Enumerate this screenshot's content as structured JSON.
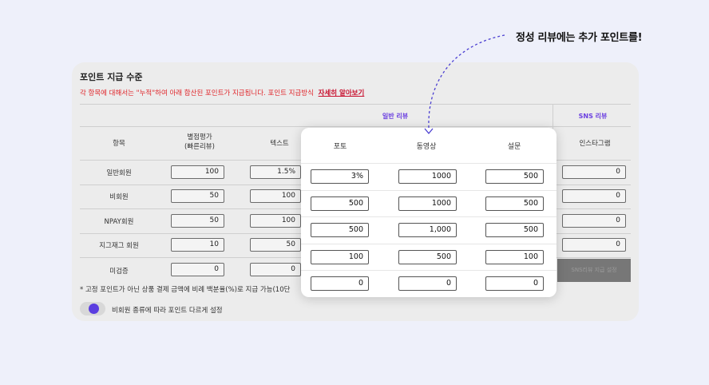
{
  "callout": "정성 리뷰에는 추가 포인트를!",
  "card": {
    "title": "포인트 지급 수준",
    "notice": "각 항목에 대해서는 \"누적\"하여 아래 합산된 포인트가 지급됩니다. 포인트 지급방식",
    "notice_link": "자세히 알아보기",
    "group_general": "일반 리뷰",
    "group_sns": "SNS 리뷰",
    "col_item": "항목",
    "col_star_1": "별점평가",
    "col_star_2": "(빠른리뷰)",
    "col_text": "텍스트",
    "col_instagram": "인스타그램",
    "rows": [
      {
        "label": "일반회원",
        "star": "100",
        "text": "1.5%",
        "insta": "0"
      },
      {
        "label": "비회원",
        "star": "50",
        "text": "100",
        "insta": "0"
      },
      {
        "label": "NPAY회원",
        "star": "50",
        "text": "100",
        "insta": "0"
      },
      {
        "label": "지그재그 회원",
        "star": "10",
        "text": "50",
        "insta": "0"
      },
      {
        "label": "미검증",
        "star": "0",
        "text": "0"
      }
    ],
    "sns_button": "SNS리뷰 지급 설정",
    "footnote": "* 고정 포인트가 아닌 상품 결제 금액에 비례 백분율(%)로 지급 가능(10단",
    "toggle_label": "비회원 종류에 따라 포인트 다르게 설정"
  },
  "panel": {
    "col_photo": "포토",
    "col_video": "동영상",
    "col_survey": "설문",
    "rows": [
      {
        "photo": "3%",
        "video": "1000",
        "survey": "500"
      },
      {
        "photo": "500",
        "video": "1000",
        "survey": "500"
      },
      {
        "photo": "500",
        "video": "1,000",
        "survey": "500"
      },
      {
        "photo": "100",
        "video": "500",
        "survey": "100"
      },
      {
        "photo": "0",
        "video": "0",
        "survey": "0"
      }
    ]
  },
  "colors": {
    "accent": "#5b3ee0",
    "notice": "#e0262b",
    "arrow": "#4b3fd1"
  }
}
